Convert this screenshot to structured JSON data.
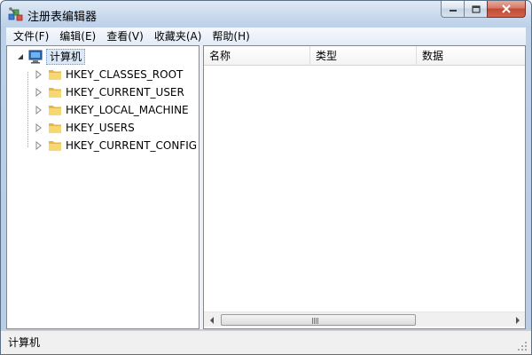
{
  "window": {
    "title": "注册表编辑器",
    "icon": "registry-editor-icon"
  },
  "menu": {
    "items": [
      {
        "label": "文件(F)"
      },
      {
        "label": "编辑(E)"
      },
      {
        "label": "查看(V)"
      },
      {
        "label": "收藏夹(A)"
      },
      {
        "label": "帮助(H)"
      }
    ]
  },
  "tree": {
    "root": {
      "label": "计算机",
      "icon": "computer-icon",
      "expanded": true
    },
    "children": [
      {
        "label": "HKEY_CLASSES_ROOT",
        "icon": "folder-icon"
      },
      {
        "label": "HKEY_CURRENT_USER",
        "icon": "folder-icon"
      },
      {
        "label": "HKEY_LOCAL_MACHINE",
        "icon": "folder-icon"
      },
      {
        "label": "HKEY_USERS",
        "icon": "folder-icon"
      },
      {
        "label": "HKEY_CURRENT_CONFIG",
        "icon": "folder-icon"
      }
    ]
  },
  "list": {
    "columns": [
      {
        "label": "名称"
      },
      {
        "label": "类型"
      },
      {
        "label": "数据"
      }
    ],
    "rows": []
  },
  "status": {
    "text": "计算机"
  },
  "colors": {
    "frame": "#b9cde6",
    "close_button": "#c14a33",
    "folder": "#f2cd5c",
    "selection": "#dbe8f8"
  }
}
